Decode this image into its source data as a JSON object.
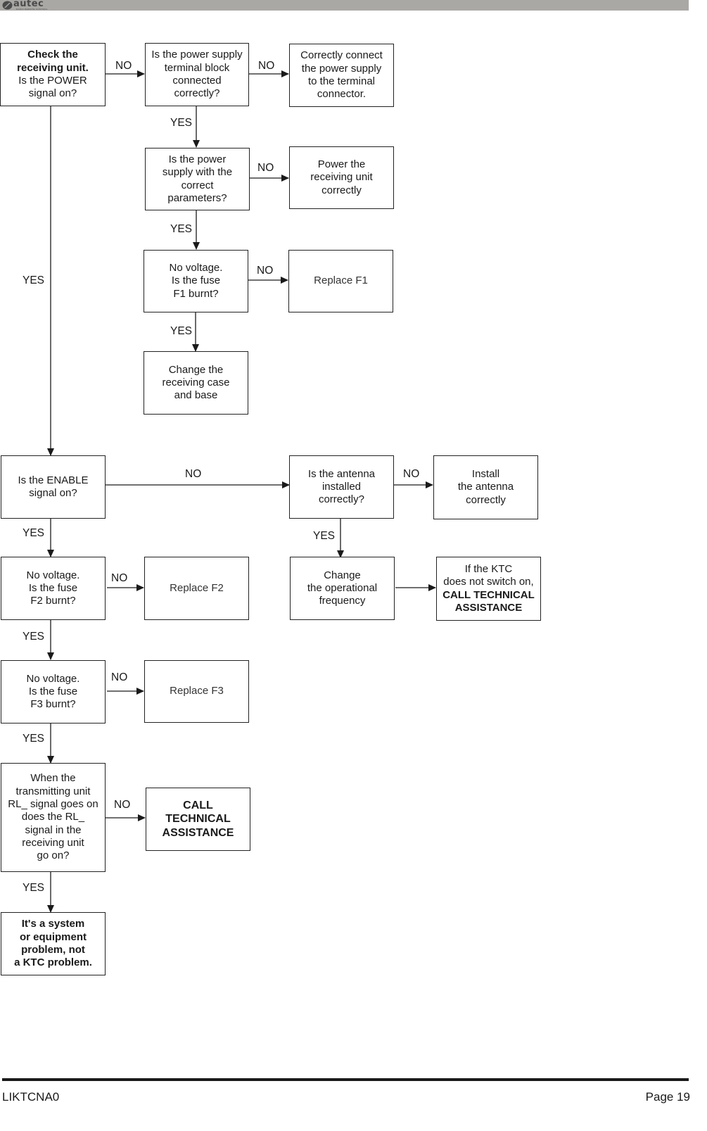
{
  "header": {
    "brand": "autec",
    "brand_tagline": "RADIO REMOTE CONTROL",
    "bar_color": "#aaa8a5"
  },
  "flowchart": {
    "nodes": {
      "check_power": {
        "bold": "Check the\nreceiving unit.",
        "text": "Is the POWER\nsignal on?"
      },
      "terminal_block": {
        "text": "Is the power supply\nterminal block\nconnected\ncorrectly?"
      },
      "connect_power": {
        "text": "Correctly connect\nthe power supply\nto the terminal\nconnector."
      },
      "correct_params": {
        "text": "Is the power\nsupply with the\ncorrect\nparameters?"
      },
      "power_unit": {
        "text": "Power the\nreceiving unit\ncorrectly"
      },
      "fuse_f1": {
        "text": "No voltage.\nIs the fuse\nF1 burnt?"
      },
      "replace_f1": {
        "text": "Replace F1"
      },
      "change_case": {
        "text": "Change the\nreceiving case\nand base"
      },
      "enable_signal": {
        "text": "Is the ENABLE\nsignal on?"
      },
      "antenna_installed": {
        "text": "Is the antenna\ninstalled\ncorrectly?"
      },
      "install_antenna": {
        "text": "Install\nthe antenna\ncorrectly"
      },
      "fuse_f2": {
        "text": "No voltage.\nIs the fuse\nF2 burnt?"
      },
      "replace_f2": {
        "text": "Replace F2"
      },
      "change_frequency": {
        "text": "Change\nthe operational\nfrequency"
      },
      "ktc_switch": {
        "text": "If the KTC\ndoes not switch on,",
        "bold": "CALL TECHNICAL\nASSISTANCE"
      },
      "fuse_f3": {
        "text": "No voltage.\nIs the fuse\nF3 burnt?"
      },
      "replace_f3": {
        "text": "Replace F3"
      },
      "rl_signal": {
        "text": "When the\ntransmitting unit\nRL_ signal goes on\ndoes the RL_\nsignal in the\nreceiving unit\ngo on?"
      },
      "call_assistance": {
        "bold": "CALL\nTECHNICAL\nASSISTANCE"
      },
      "system_problem": {
        "bold": "It's a system\nor equipment\nproblem, not\na KTC problem."
      }
    },
    "labels": {
      "yes": "YES",
      "no": "NO"
    }
  },
  "footer": {
    "doc_code": "LIKTCNA0",
    "page": "Page 19"
  }
}
